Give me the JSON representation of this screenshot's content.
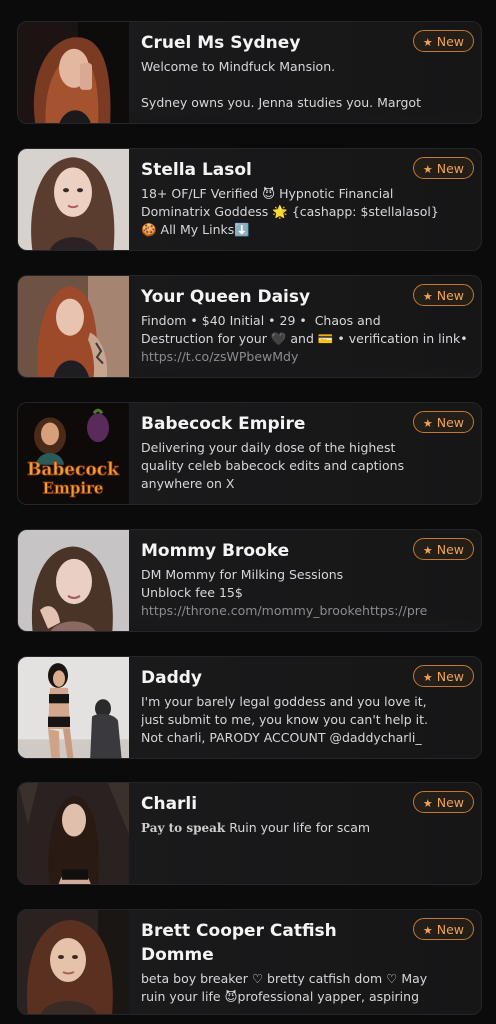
{
  "badge_label": "New",
  "badge_icon": "star-icon",
  "colors": {
    "accent": "#f0a356",
    "card_bg": "#1b1b1d",
    "page_bg": "#0b0b0c"
  },
  "cards": [
    {
      "name": "Cruel Ms Sydney",
      "desc_line1": "Welcome to Mindfuck Mansion.",
      "desc_line2": "",
      "desc_line3": "Sydney owns you. Jenna studies you. Margot humiliates you. Taylor ruins you."
    },
    {
      "name": "Stella Lasol",
      "desc_line1": "18+ OF/LF Verified 😈 Hypnotic Financial",
      "desc_line2": "Dominatrix Goddess 🌟 {cashapp: $stellalasol}",
      "desc_line3": "🍪 All My Links⬇️"
    },
    {
      "name": "Your Queen Daisy",
      "desc_line1": "Findom • $40 Initial • 29 •  Chaos and",
      "desc_line2": "Destruction for your 🖤 and 💳 • verification in link•",
      "desc_line3": "https://t.co/zsWPbewMdy"
    },
    {
      "name": "Babecock Empire",
      "desc_line1": "Delivering your daily dose of the highest",
      "desc_line2": "quality celeb babecock edits and captions",
      "desc_line3": "anywhere on X",
      "logo_text_1": "Babecock",
      "logo_text_2": "Empire"
    },
    {
      "name": "Mommy Brooke",
      "desc_line1": "DM Mommy for Milking Sessions",
      "desc_line2": "Unblock fee 15$",
      "desc_line3": "https://throne.com/mommy_brookehttps://pre"
    },
    {
      "name": "Daddy",
      "desc_line1": "I'm your barely legal goddess and you love it,",
      "desc_line2": "just submit to me, you know you can't help it.",
      "desc_line3": "Not charli, PARODY ACCOUNT @daddycharli_"
    },
    {
      "name": "Charli",
      "desc_prefix": "Pay to speak",
      "desc_line1": " Ruin your life for scam"
    },
    {
      "name": "Brett Cooper Catfish Domme",
      "desc_line1": "beta boy breaker ♡ bretty catfish dom ♡ May",
      "desc_line2": "ruin your life 😈professional yapper, aspiring",
      "desc_line3": ""
    }
  ]
}
